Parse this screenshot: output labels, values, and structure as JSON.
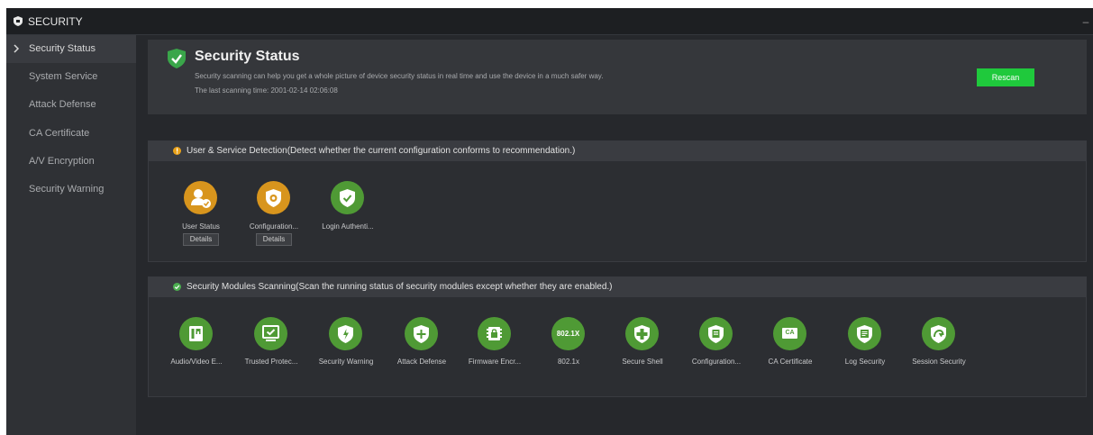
{
  "window": {
    "title": "SECURITY",
    "minimize_label": "–"
  },
  "sidebar": {
    "items": [
      {
        "label": "Security Status",
        "active": true
      },
      {
        "label": "System Service"
      },
      {
        "label": "Attack Defense"
      },
      {
        "label": "CA Certificate"
      },
      {
        "label": "A/V Encryption"
      },
      {
        "label": "Security Warning"
      }
    ]
  },
  "status": {
    "title": "Security Status",
    "description": "Security scanning can help you get a whole picture of device security status in real time and use the device in a much safer way.",
    "last_scan": "The last scanning time: 2001-02-14 02:06:08",
    "rescan_label": "Rescan"
  },
  "detection": {
    "heading": "User & Service Detection(Detect whether the current configuration conforms to recommendation.)",
    "items": [
      {
        "label": "User Status",
        "icon": "user-check-icon",
        "state": "warning",
        "details_label": "Details"
      },
      {
        "label": "Configuration...",
        "icon": "config-gear-icon",
        "state": "warning",
        "details_label": "Details"
      },
      {
        "label": "Login Authenti...",
        "icon": "shield-check-icon",
        "state": "ok"
      }
    ]
  },
  "modules": {
    "heading": "Security Modules Scanning(Scan the running status of security modules except whether they are enabled.)",
    "items": [
      {
        "label": "Audio/Video E...",
        "icon": "av-encryption-icon"
      },
      {
        "label": "Trusted Protec...",
        "icon": "trusted-monitor-icon"
      },
      {
        "label": "Security Warning",
        "icon": "warning-shield-icon"
      },
      {
        "label": "Attack Defense",
        "icon": "plus-shield-icon"
      },
      {
        "label": "Firmware Encr...",
        "icon": "chip-lock-icon"
      },
      {
        "label": "802.1x",
        "icon": "8021x-icon",
        "icon_text": "802.1X"
      },
      {
        "label": "Secure Shell",
        "icon": "shell-shield-icon"
      },
      {
        "label": "Configuration...",
        "icon": "config-doc-icon"
      },
      {
        "label": "CA Certificate",
        "icon": "ca-cert-icon",
        "icon_text": "CA"
      },
      {
        "label": "Log Security",
        "icon": "log-shield-icon"
      },
      {
        "label": "Session Security",
        "icon": "session-shield-icon"
      }
    ]
  },
  "colors": {
    "accent_green": "#1fc93c",
    "ok_green": "#4f9a35",
    "warn_orange": "#d8951d",
    "background": "#26282c"
  }
}
